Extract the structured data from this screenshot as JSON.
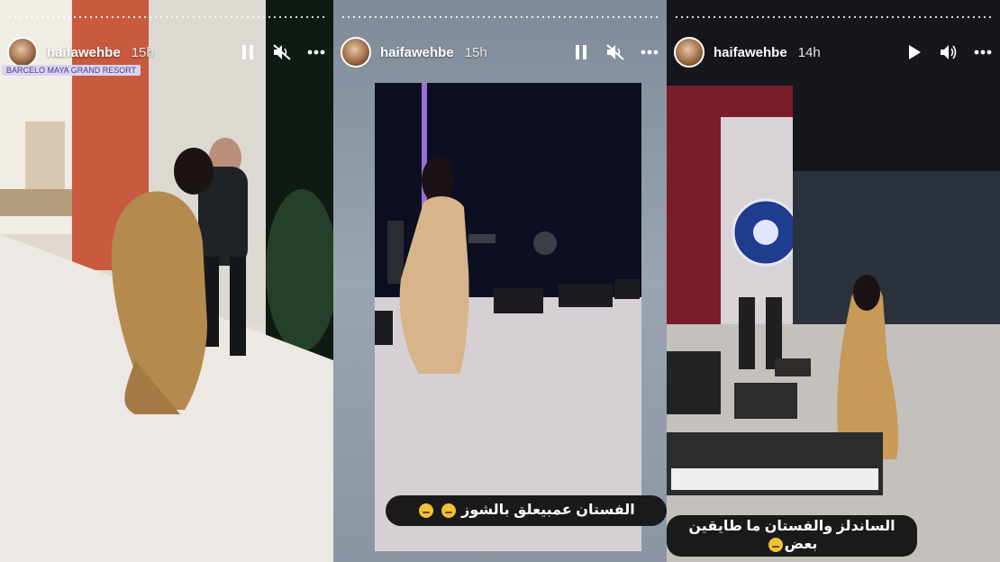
{
  "stories": [
    {
      "username": "haifawehbe",
      "time": "15h",
      "location": "BARCELO MAYA GRAND RESORT",
      "controls": [
        "pause-icon",
        "mute-icon",
        "more-icon"
      ]
    },
    {
      "username": "haifawehbe",
      "time": "15h",
      "caption": "الفستان عمبيعلق بالشوز",
      "controls": [
        "pause-icon",
        "mute-icon",
        "more-icon"
      ]
    },
    {
      "username": "haifawehbe",
      "time": "14h",
      "caption_line1": "الساندلز والفستان ما طايقين",
      "caption_line2": "بعض",
      "controls": [
        "play-icon",
        "volume-icon",
        "more-icon"
      ]
    }
  ]
}
